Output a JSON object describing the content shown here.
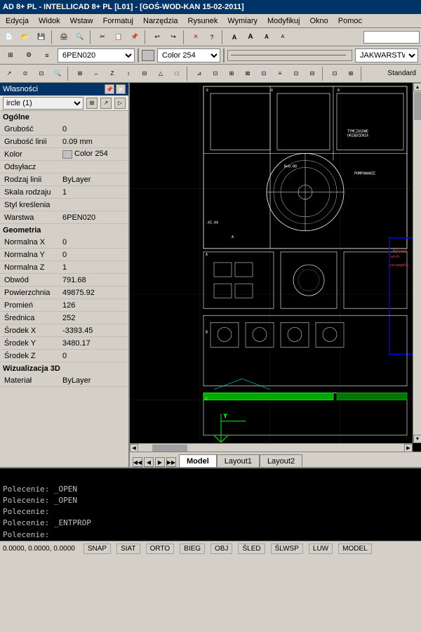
{
  "titlebar": {
    "text": "AD 8+ PL - INTELLICAD 8+ PL [L01] - [GOŚ-WOD-KAN 15-02-2011]"
  },
  "menubar": {
    "items": [
      "Edycja",
      "Widok",
      "Wstaw",
      "Formatuj",
      "Narzędzia",
      "Rysunek",
      "Wymiary",
      "Modyfikuj",
      "Okno",
      "Pomoc"
    ]
  },
  "dropdown_bar": {
    "layer_value": "6PEN020",
    "color_value": "Color 254",
    "linetype_value": "JAKWARSTWA"
  },
  "properties": {
    "title": "Własności",
    "selector_value": "ircle (1)",
    "sections": [
      {
        "header": "Ogólne",
        "rows": [
          {
            "label": "Grubość",
            "value": "0"
          },
          {
            "label": "Grubość linii",
            "value": "0.09 mm"
          },
          {
            "label": "Kolor",
            "value": "Color 254",
            "has_color": true
          },
          {
            "label": "Odsyłacz",
            "value": ""
          },
          {
            "label": "Rodzaj linii",
            "value": "ByLayer"
          },
          {
            "label": "Skala rodzaju",
            "value": "1"
          },
          {
            "label": "Styl kreślenia",
            "value": ""
          },
          {
            "label": "Warstwa",
            "value": "6PEN020"
          }
        ]
      },
      {
        "header": "Geometria",
        "rows": [
          {
            "label": "Normalna X",
            "value": "0"
          },
          {
            "label": "Normalna Y",
            "value": "0"
          },
          {
            "label": "Normalna Z",
            "value": "1"
          },
          {
            "label": "Obwód",
            "value": "791.68"
          },
          {
            "label": "Powierzchnia",
            "value": "49875.92"
          },
          {
            "label": "Promień",
            "value": "126"
          },
          {
            "label": "Średnica",
            "value": "252"
          },
          {
            "label": "Środek X",
            "value": "-3393.45"
          },
          {
            "label": "Środek Y",
            "value": "3480.17"
          },
          {
            "label": "Środek Z",
            "value": "0"
          }
        ]
      },
      {
        "header": "Wizualizacja 3D",
        "rows": [
          {
            "label": "Materiał",
            "value": "ByLayer"
          }
        ]
      }
    ]
  },
  "cad_tabs": {
    "nav_buttons": [
      "◀◀",
      "◀",
      "▶",
      "▶▶"
    ],
    "tabs": [
      "Model",
      "Layout1",
      "Layout2"
    ],
    "active_tab": "Model"
  },
  "command_lines": [
    "Polecenie:  _OPEN",
    "Polecenie:  _OPEN",
    "Polecenie:",
    "Polecenie:  _ENTPROP",
    "Polecenie:"
  ],
  "status_bar": {
    "buttons": [
      "SNAP",
      "SIAT",
      "ORTO",
      "BIEG",
      "OBJ",
      "ŚLED",
      "ŚLWSP",
      "LUW",
      "MODEL"
    ],
    "coords": "0.0000, 0.0000, 0.0000"
  },
  "toolbar_standard": "Standard"
}
